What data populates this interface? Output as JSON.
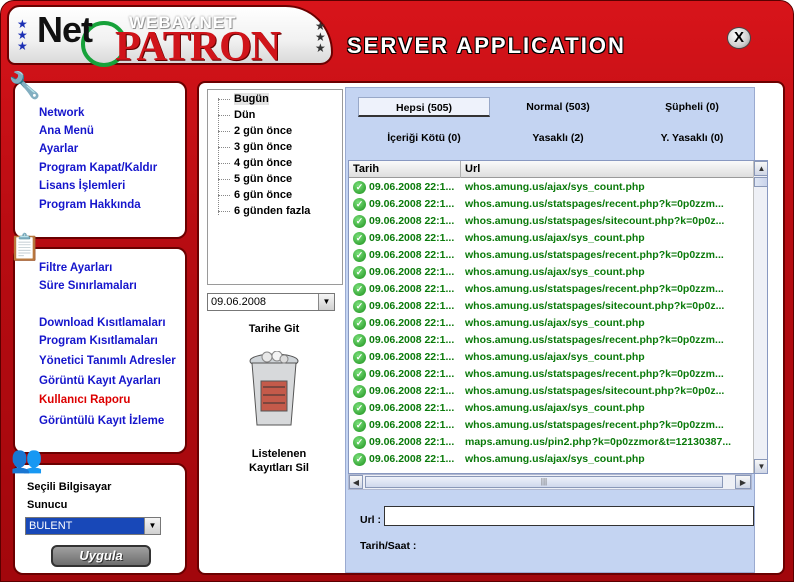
{
  "header": {
    "logo_net": "Net",
    "logo_webay": "WEBAY.NET",
    "logo_patron": "PATRON",
    "title": "SERVER APPLICATION",
    "close_label": "X"
  },
  "left_menu_1": [
    "Network",
    "Ana Menü",
    "Ayarlar",
    "Program Kapat/Kaldır",
    "Lisans İşlemleri",
    "Program Hakkında"
  ],
  "left_menu_2": {
    "top": [
      "Filtre Ayarları",
      "Süre Sınırlamaları"
    ],
    "bottom": [
      "Download Kısıtlamaları",
      "Program Kısıtlamaları",
      "Yönetici Tanımlı Adresler",
      "Görüntü Kayıt Ayarları",
      "Kullanıcı Raporu",
      "Görüntülü Kayıt İzleme"
    ]
  },
  "computer_panel": {
    "label_1": "Seçili Bilgisayar",
    "label_2": "Sunucu",
    "selected": "BULENT",
    "apply_label": "Uygula"
  },
  "date_tree": [
    "Bugün",
    "Dün",
    "2 gün önce",
    "3 gün önce",
    "4 gün önce",
    "5 gün önce",
    "6 gün önce",
    "6 günden fazla"
  ],
  "date_picker": {
    "value": "09.06.2008",
    "go_label": "Tarihe Git"
  },
  "delete_listed": {
    "line1": "Listelenen",
    "line2": "Kayıtları Sil"
  },
  "tabs": [
    "Hepsi (505)",
    "Normal (503)",
    "Şüpheli (0)",
    "İçeriği Kötü (0)",
    "Yasaklı (2)",
    "Y. Yasaklı (0)"
  ],
  "grid": {
    "columns": [
      "Tarih",
      "Url"
    ],
    "rows": [
      [
        "09.06.2008 22:1...",
        "whos.amung.us/ajax/sys_count.php"
      ],
      [
        "09.06.2008 22:1...",
        "whos.amung.us/statspages/recent.php?k=0p0zzm..."
      ],
      [
        "09.06.2008 22:1...",
        "whos.amung.us/statspages/sitecount.php?k=0p0z..."
      ],
      [
        "09.06.2008 22:1...",
        "whos.amung.us/ajax/sys_count.php"
      ],
      [
        "09.06.2008 22:1...",
        "whos.amung.us/statspages/recent.php?k=0p0zzm..."
      ],
      [
        "09.06.2008 22:1...",
        "whos.amung.us/ajax/sys_count.php"
      ],
      [
        "09.06.2008 22:1...",
        "whos.amung.us/statspages/recent.php?k=0p0zzm..."
      ],
      [
        "09.06.2008 22:1...",
        "whos.amung.us/statspages/sitecount.php?k=0p0z..."
      ],
      [
        "09.06.2008 22:1...",
        "whos.amung.us/ajax/sys_count.php"
      ],
      [
        "09.06.2008 22:1...",
        "whos.amung.us/statspages/recent.php?k=0p0zzm..."
      ],
      [
        "09.06.2008 22:1...",
        "whos.amung.us/ajax/sys_count.php"
      ],
      [
        "09.06.2008 22:1...",
        "whos.amung.us/statspages/recent.php?k=0p0zzm..."
      ],
      [
        "09.06.2008 22:1...",
        "whos.amung.us/statspages/sitecount.php?k=0p0z..."
      ],
      [
        "09.06.2008 22:1...",
        "whos.amung.us/ajax/sys_count.php"
      ],
      [
        "09.06.2008 22:1...",
        "whos.amung.us/statspages/recent.php?k=0p0zzm..."
      ],
      [
        "09.06.2008 22:1...",
        "maps.amung.us/pin2.php?k=0p0zzmor&t=12130387..."
      ],
      [
        "09.06.2008 22:1...",
        "whos.amung.us/ajax/sys_count.php"
      ]
    ]
  },
  "details": {
    "url_label": "Url :",
    "url_value": "",
    "timestamp_label": "Tarih/Saat :"
  },
  "colors": {
    "frame_red": "#c40f15",
    "link_blue": "#1515cc",
    "link_red": "#dd0000",
    "row_green": "#0a7a0a",
    "panel_blue": "#c4d4f2"
  }
}
